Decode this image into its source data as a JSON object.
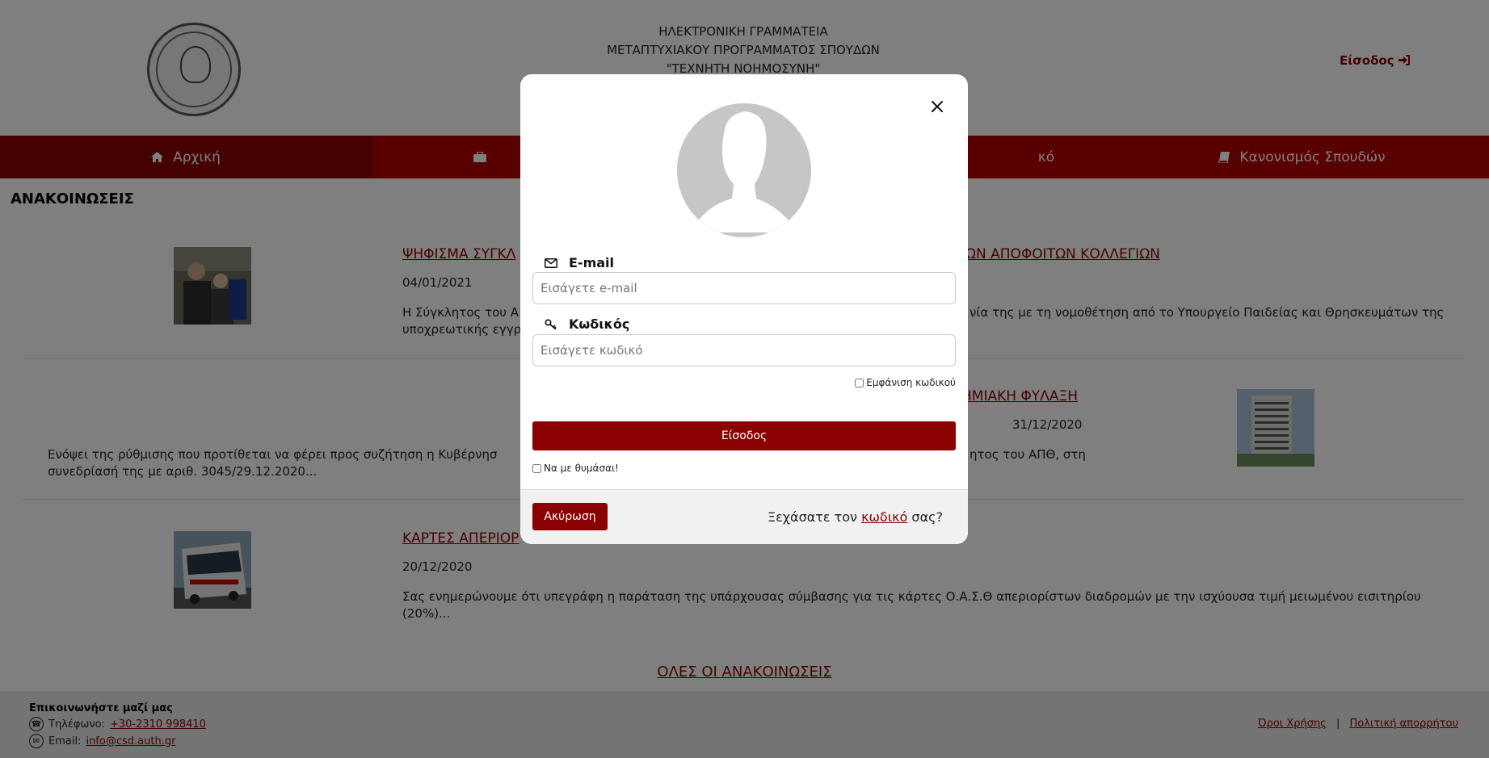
{
  "header": {
    "line1": "ΗΛΕΚΤΡΟΝΙΚΗ ΓΡΑΜΜΑΤΕΙΑ",
    "line2": "ΜΕΤΑΠΤΥΧΙΑΚΟΥ ΠΡΟΓΡΑΜΜΑΤΟΣ ΣΠΟΥΔΩΝ",
    "line3": "\"ΤΕΧΝΗΤΗ ΝΟΗΜΟΣΥΝΗ\"",
    "login_label": "Είσοδος"
  },
  "nav": {
    "items": [
      {
        "label": "Αρχική",
        "icon": "home-icon"
      },
      {
        "label": "",
        "icon": "briefcase-icon"
      },
      {
        "label": "κό",
        "icon": ""
      },
      {
        "label": "Κανονισμός Σπουδών",
        "icon": "book-icon"
      }
    ]
  },
  "section_title": "ΑΝΑΚΟΙΝΩΣΕΙΣ",
  "announcements": [
    {
      "title_left": "ΨΗΦΙΣΜΑ ΣΥΓΚΛ",
      "title_right": "ΩΝ ΑΠΟΦΟΙΤΩΝ ΚΟΛΛΕΓΙΩΝ",
      "date": "04/01/2021",
      "text_right": "Η Σύγκλητος του Α",
      "text_right2": "νία της με τη νομοθέτηση από το Υπουργείο Παιδείας και Θρησκευμάτων της",
      "text_line2": "υποχρεωτικής εγγρ"
    },
    {
      "title_right": "ΗΜΙΑΚΗ ΦΥΛΑΞΗ",
      "date": "31/12/2020",
      "text_left": "Ενόψει της ρύθμισης που προτίθεται να φέρει προς συζήτηση η Κυβέρνησ",
      "text_right": "ητος του ΑΠΘ, στη",
      "text_line2": "συνεδρίασή της με αριθ. 3045/29.12.2020..."
    },
    {
      "title_left": "ΚΑΡΤΕΣ ΑΠΕΡΙΟΡ",
      "date": "20/12/2020",
      "text_line1": "Σας ενημερώνουμε ότι υπεγράφη η παράταση της υπάρχουσας σύμβασης για τις κάρτες Ο.Α.Σ.Θ απεριορίστων διαδρομών με την ισχύουσα τιμή μειωμένου εισιτηρίου",
      "text_line2": "(20%)..."
    }
  ],
  "all_link": "ΟΛΕΣ ΟΙ ΑΝΑΚΟΙΝΩΣΕΙΣ",
  "footer": {
    "title": "Επικοινωνήστε μαζί μας",
    "phone_label": "Τηλέφωνο:",
    "phone_value": "+30-2310 998410",
    "email_label": "Email:",
    "email_value": "info@csd.auth.gr",
    "terms": "Όροι Χρήσης",
    "separator": "|",
    "privacy": "Πολιτική απορρήτου"
  },
  "modal": {
    "email_label": "E-mail",
    "email_placeholder": "Εισάγετε e-mail",
    "password_label": "Κωδικός",
    "password_placeholder": "Εισάγετε κωδικό",
    "show_password": "Εμφάνιση κωδικού",
    "submit": "Είσοδος",
    "remember": "Να με θυμάσαι!",
    "cancel": "Ακύρωση",
    "forgot_prefix": "Ξεχάσατε τον",
    "forgot_link": "κωδικό",
    "forgot_suffix": "σας?"
  },
  "colors": {
    "brand": "#8b0000",
    "nav": "#b30000",
    "overlay": "rgba(0,0,0,0.5)"
  }
}
